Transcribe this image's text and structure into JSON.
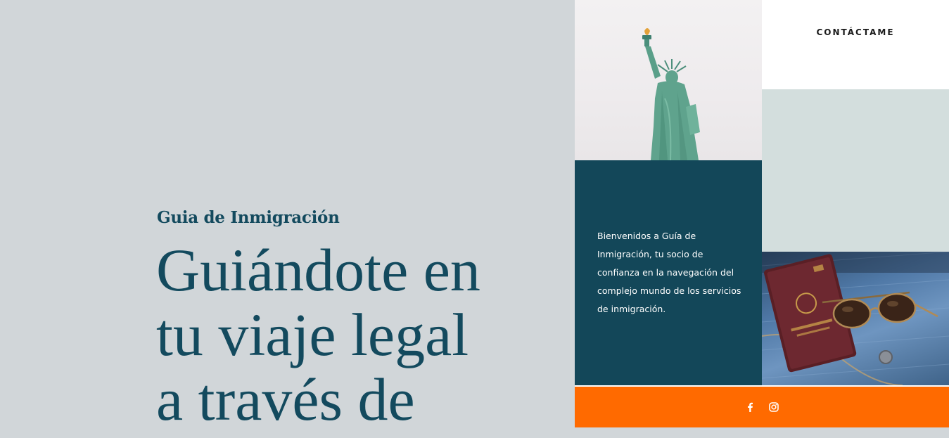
{
  "hero": {
    "eyebrow": "Guia de Inmigración",
    "headline_lines": [
      "Guiándote en",
      "tu viaje legal",
      "a través de"
    ]
  },
  "nav": {
    "contact_label": "CONTÁCTAME"
  },
  "intro": {
    "text": "Bienvenidos a Guía de Inmigración, tu socio de confianza en la navegación del complejo mundo de los servicios de inmigración."
  },
  "social": {
    "icons": [
      "facebook-icon",
      "instagram-icon"
    ]
  },
  "colors": {
    "background": "#d1d6d9",
    "heading": "#134a5e",
    "teal_block": "#134759",
    "mint_block": "#d3dedd",
    "accent_orange": "#ff6a00",
    "white": "#ffffff"
  }
}
